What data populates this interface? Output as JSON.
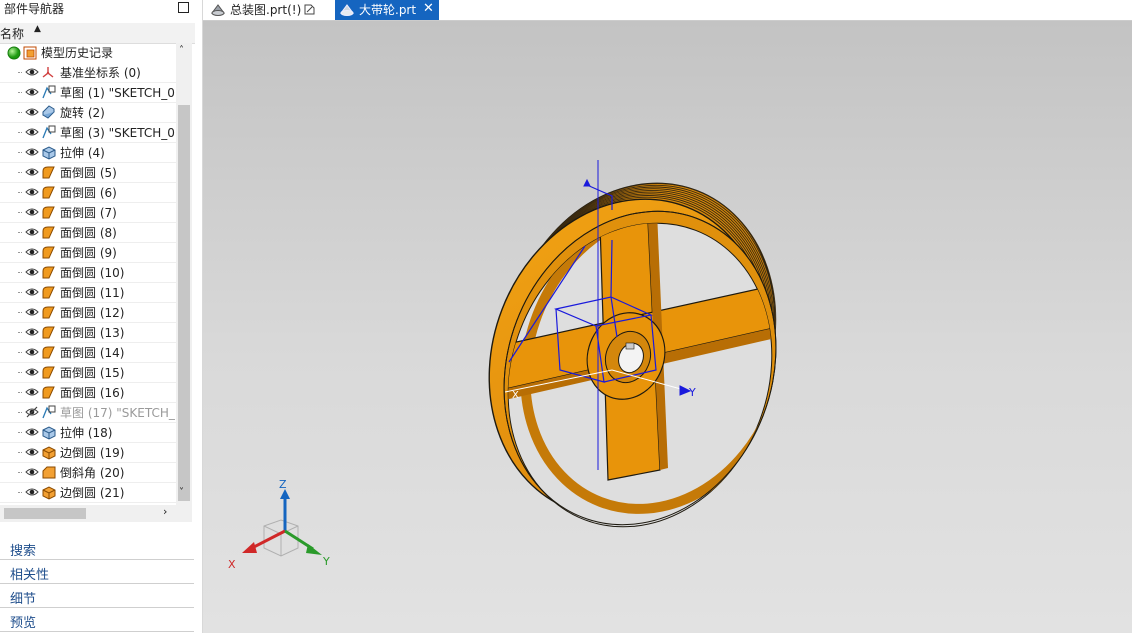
{
  "navigator": {
    "title": "部件导航器",
    "column_name": "名称",
    "root_label": "模型历史记录",
    "items": [
      {
        "label": "基准坐标系 (0)",
        "type": "csys",
        "dim": false
      },
      {
        "label": "草图 (1) \"SKETCH_0...",
        "type": "sketch",
        "dim": false
      },
      {
        "label": "旋转 (2)",
        "type": "revolve",
        "dim": false
      },
      {
        "label": "草图 (3) \"SKETCH_0...",
        "type": "sketch",
        "dim": false
      },
      {
        "label": "拉伸 (4)",
        "type": "extrude",
        "dim": false
      },
      {
        "label": "面倒圆 (5)",
        "type": "blend",
        "dim": false
      },
      {
        "label": "面倒圆 (6)",
        "type": "blend",
        "dim": false
      },
      {
        "label": "面倒圆 (7)",
        "type": "blend",
        "dim": false
      },
      {
        "label": "面倒圆 (8)",
        "type": "blend",
        "dim": false
      },
      {
        "label": "面倒圆 (9)",
        "type": "blend",
        "dim": false
      },
      {
        "label": "面倒圆 (10)",
        "type": "blend",
        "dim": false
      },
      {
        "label": "面倒圆 (11)",
        "type": "blend",
        "dim": false
      },
      {
        "label": "面倒圆 (12)",
        "type": "blend",
        "dim": false
      },
      {
        "label": "面倒圆 (13)",
        "type": "blend",
        "dim": false
      },
      {
        "label": "面倒圆 (14)",
        "type": "blend",
        "dim": false
      },
      {
        "label": "面倒圆 (15)",
        "type": "blend",
        "dim": false
      },
      {
        "label": "面倒圆 (16)",
        "type": "blend",
        "dim": false
      },
      {
        "label": "草图 (17) \"SKETCH_...",
        "type": "sketch",
        "dim": true
      },
      {
        "label": "拉伸 (18)",
        "type": "extrude",
        "dim": false
      },
      {
        "label": "边倒圆 (19)",
        "type": "edgeblend",
        "dim": false
      },
      {
        "label": "倒斜角 (20)",
        "type": "chamfer",
        "dim": false
      },
      {
        "label": "边倒圆 (21)",
        "type": "edgeblend",
        "dim": false
      }
    ],
    "sections": [
      "搜索",
      "相关性",
      "细节",
      "预览"
    ]
  },
  "tabs": [
    {
      "label": "总装图.prt(!)",
      "active": false
    },
    {
      "label": "大带轮.prt",
      "active": true
    }
  ],
  "triad": {
    "x": "X",
    "y": "Y",
    "z": "Z"
  },
  "csys_labels": {
    "x": "X",
    "y": "Y"
  },
  "colors": {
    "accent": "#1565c0",
    "part": "#e8940a",
    "part_edge": "#1e1a10",
    "sketch": "#1a1adc"
  }
}
